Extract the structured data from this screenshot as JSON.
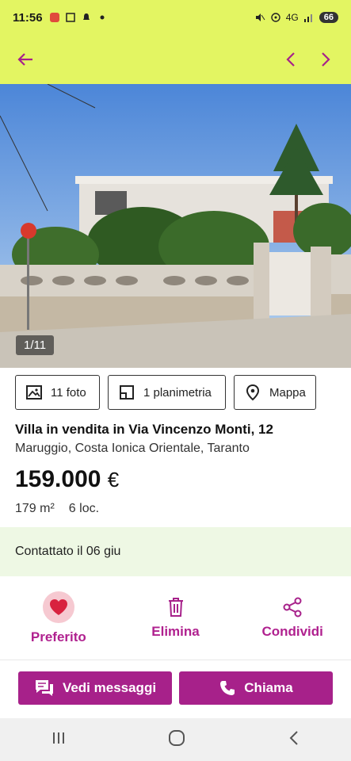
{
  "status_bar": {
    "time": "11:56",
    "network": "4G",
    "battery": "66"
  },
  "app_bar": {
    "back_icon": "arrow-left-icon",
    "prev_icon": "chevron-left-icon",
    "next_icon": "chevron-right-icon"
  },
  "gallery": {
    "counter": "1/11"
  },
  "chips": {
    "photos": "11 foto",
    "plans": "1 planimetria",
    "map": "Mappa"
  },
  "listing": {
    "title": "Villa in vendita in Via Vincenzo Monti, 12",
    "location": "Maruggio, Costa Ionica Orientale, Taranto",
    "price_value": "159.000",
    "price_currency": "€",
    "area": "179 m²",
    "rooms": "6 loc."
  },
  "contact_status": "Contattato il 06 giu",
  "actions": {
    "favorite": "Preferito",
    "delete": "Elimina",
    "share": "Condividi"
  },
  "buttons": {
    "messages": "Vedi messaggi",
    "call": "Chiama"
  },
  "colors": {
    "header_bg": "#e3f562",
    "accent": "#a7218a",
    "contact_band": "#eef8e4",
    "favorite_heart": "#d8223f"
  }
}
